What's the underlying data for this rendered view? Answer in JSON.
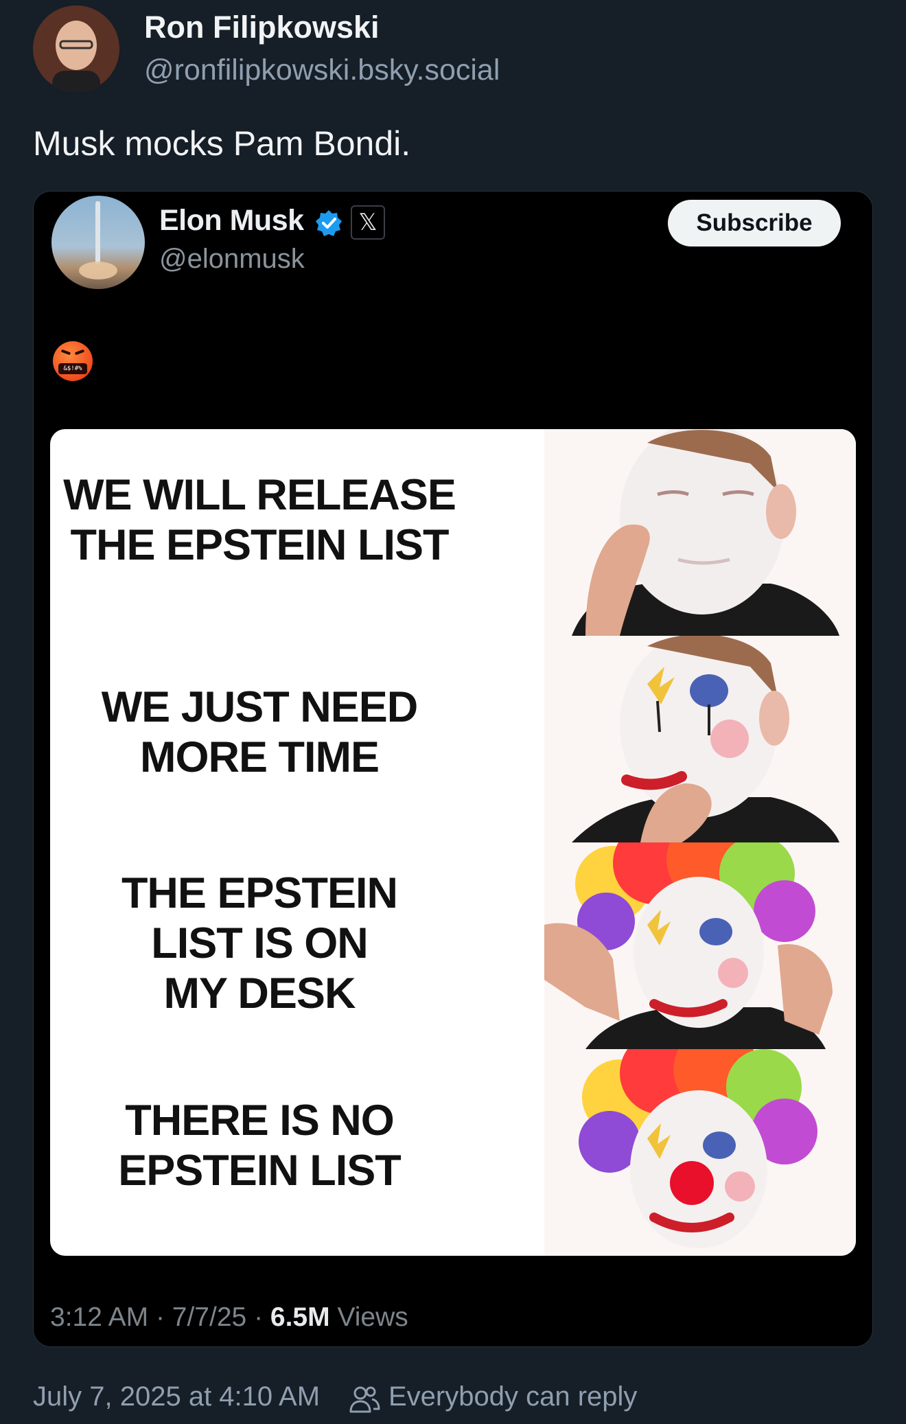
{
  "post": {
    "author_name": "Ron Filipkowski",
    "author_handle": "@ronfilipkowski.bsky.social",
    "text": "Musk mocks Pam Bondi.",
    "timestamp": "July 7, 2025 at 4:10 AM",
    "reply_setting": "Everybody can reply"
  },
  "embed": {
    "name": "Elon Musk",
    "x_badge": "𝕏",
    "handle": "@elonmusk",
    "subscribe_label": "Subscribe",
    "emoji_text": "&$!#%",
    "meme": [
      {
        "line1": "WE WILL RELEASE",
        "line2": "THE EPSTEIN LIST",
        "line3": ""
      },
      {
        "line1": "WE JUST NEED",
        "line2": "MORE TIME",
        "line3": ""
      },
      {
        "line1": "THE EPSTEIN",
        "line2": "LIST IS ON",
        "line3": "MY DESK"
      },
      {
        "line1": "THERE IS NO",
        "line2": "EPSTEIN LIST",
        "line3": ""
      }
    ],
    "time": "3:12 AM",
    "sep1": "·",
    "date": "7/7/25",
    "sep2": "·",
    "views_count": "6.5M",
    "views_label": "Views"
  }
}
